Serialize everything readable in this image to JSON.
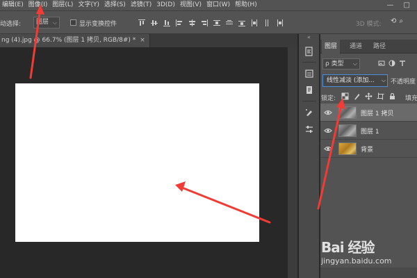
{
  "menu": {
    "items": [
      "编辑(E)",
      "图像(I)",
      "图层(L)",
      "文字(Y)",
      "选择(S)",
      "滤镜(T)",
      "3D(D)",
      "视图(V)",
      "窗口(W)",
      "帮助(H)"
    ],
    "window_buttons": [
      "—",
      "□"
    ]
  },
  "options_bar": {
    "auto_select_label": "动选择:",
    "auto_select_value": "图层",
    "show_transform_label": "显示变换控件",
    "mode_3d_label": "3D 模式:"
  },
  "document_tab": {
    "title": "ng (4).jpg @ 66.7% (图层 1 拷贝, RGB/8#) *",
    "close_glyph": "×"
  },
  "layers_panel": {
    "tabs": [
      "图层",
      "通道",
      "路径"
    ],
    "filter_label": "ρ 类型",
    "blend_mode": "线性减淡 (添加...",
    "opacity_label": "不透明度",
    "lock_label": "锁定:",
    "fill_label": "填充",
    "layers": [
      {
        "name": "图层 1 拷贝",
        "selected": true,
        "thumb": "gray"
      },
      {
        "name": "图层 1",
        "selected": false,
        "thumb": "gray"
      },
      {
        "name": "背景",
        "selected": false,
        "thumb": "color"
      }
    ]
  },
  "watermark": {
    "logo_text": "Bai 经验",
    "url": "jingyan.baidu.com"
  },
  "colors": {
    "annotation_arrow": "#f03c35",
    "selection_border": "#4a90d9"
  }
}
